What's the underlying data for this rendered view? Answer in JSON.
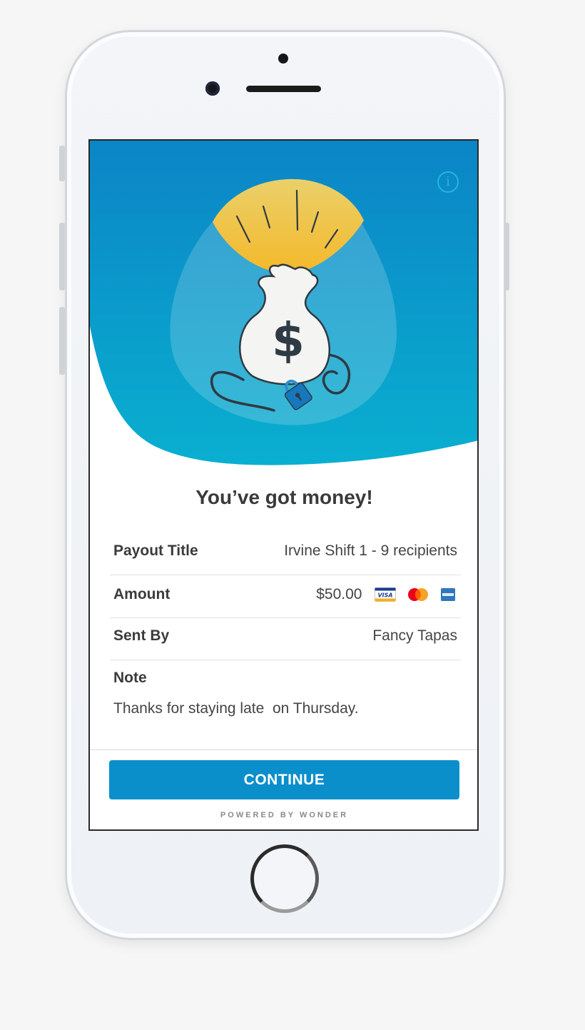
{
  "colors": {
    "hero_top": "#0b85c6",
    "hero_bottom": "#0aafd0",
    "accent": "#0a8fcb",
    "bag_light": "#f5c53a"
  },
  "header": {
    "info_icon": "info-icon",
    "headline": "You’ve got money!"
  },
  "details": {
    "payout_title_label": "Payout Title",
    "payout_title_value": "Irvine Shift 1 - 9 recipients",
    "amount_label": "Amount",
    "amount_value": "$50.00",
    "card_icons": [
      "visa-icon",
      "mastercard-icon",
      "amex-icon"
    ],
    "visa_text": "VISA",
    "sent_by_label": "Sent By",
    "sent_by_value": "Fancy Tapas",
    "note_label": "Note",
    "note_value": "Thanks for staying late  on Thursday."
  },
  "footer": {
    "continue_label": "CONTINUE",
    "powered_by": "POWERED BY WONDER"
  }
}
